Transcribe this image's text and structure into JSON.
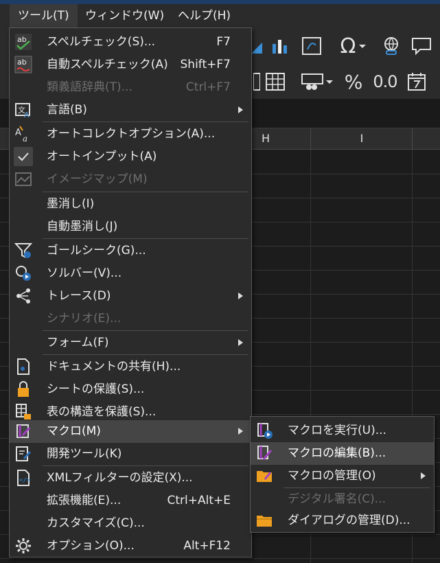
{
  "menubar": {
    "items": [
      {
        "label": "ツール(T)"
      },
      {
        "label": "ウィンドウ(W)"
      },
      {
        "label": "ヘルプ(H)"
      }
    ]
  },
  "toolbar": {
    "percent": "%",
    "decimal": "0.0",
    "omega": "Ω"
  },
  "columns": {
    "h": "H",
    "i": "I"
  },
  "tools_menu": {
    "items": [
      {
        "label": "スペルチェック(S)...",
        "shortcut": "F7",
        "icon": "spellcheck-icon"
      },
      {
        "label": "自動スペルチェック(A)",
        "shortcut": "Shift+F7",
        "icon": "auto-spellcheck-icon"
      },
      {
        "label": "類義語辞典(T)...",
        "shortcut": "Ctrl+F7",
        "disabled": true
      },
      {
        "label": "言語(B)",
        "icon": "language-icon",
        "submenu": true
      },
      {
        "label": "オートコレクトオプション(A)...",
        "icon": "autocorrect-icon"
      },
      {
        "label": "オートインプット(A)",
        "icon": "checkmark-icon",
        "checked": true
      },
      {
        "label": "イメージマップ(M)",
        "icon": "imagemap-icon",
        "disabled": true
      },
      {
        "label": "墨消し(I)"
      },
      {
        "label": "自動墨消し(J)"
      },
      {
        "label": "ゴールシーク(G)...",
        "icon": "goal-seek-icon"
      },
      {
        "label": "ソルバー(V)...",
        "icon": "solver-icon"
      },
      {
        "label": "トレース(D)",
        "icon": "trace-icon",
        "submenu": true
      },
      {
        "label": "シナリオ(E)...",
        "disabled": true
      },
      {
        "label": "フォーム(F)",
        "submenu": true
      },
      {
        "label": "ドキュメントの共有(H)...",
        "icon": "share-document-icon"
      },
      {
        "label": "シートの保護(S)...",
        "icon": "protect-sheet-icon"
      },
      {
        "label": "表の構造を保護(S)...",
        "icon": "protect-structure-icon"
      },
      {
        "label": "マクロ(M)",
        "icon": "macro-icon",
        "submenu": true,
        "highlighted": true
      },
      {
        "label": "開発ツール(K)",
        "icon": "dev-tools-icon"
      },
      {
        "label": "XMLフィルターの設定(X)...",
        "icon": "xml-filter-icon"
      },
      {
        "label": "拡張機能(E)...",
        "shortcut": "Ctrl+Alt+E"
      },
      {
        "label": "カスタマイズ(C)..."
      },
      {
        "label": "オプション(O)...",
        "shortcut": "Alt+F12",
        "icon": "options-gear-icon"
      }
    ]
  },
  "macro_submenu": {
    "items": [
      {
        "label": "マクロを実行(U)...",
        "icon": "run-macro-icon"
      },
      {
        "label": "マクロの編集(B)...",
        "icon": "edit-macro-icon",
        "highlighted": true
      },
      {
        "label": "マクロの管理(O)",
        "icon": "manage-macros-folder-icon",
        "submenu": true
      },
      {
        "label": "デジタル署名(C)...",
        "disabled": true
      },
      {
        "label": "ダイアログの管理(D)...",
        "icon": "manage-dialogs-folder-icon"
      }
    ]
  },
  "colors": {
    "menu_bg": "#2b2b2b",
    "highlight": "#454545",
    "disabled_text": "#6e6e6e",
    "title_strip": "#1d3c66"
  }
}
